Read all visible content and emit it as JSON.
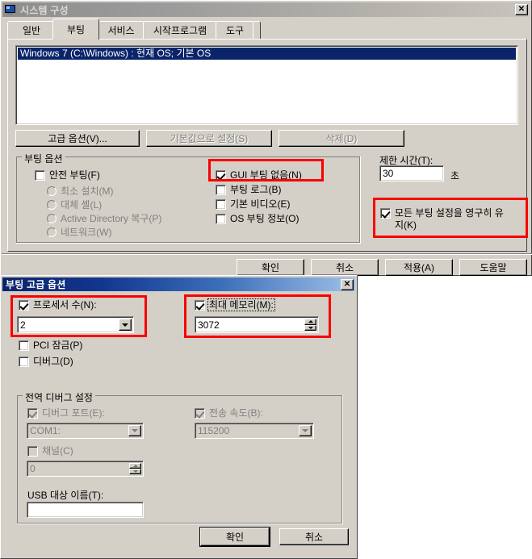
{
  "main_window": {
    "title": "시스템 구성",
    "icon": "system-config-icon",
    "close_label": "✕",
    "tabs": [
      {
        "label": "일반",
        "selected": false
      },
      {
        "label": "부팅",
        "selected": true
      },
      {
        "label": "서비스",
        "selected": false
      },
      {
        "label": "시작프로그램",
        "selected": false
      },
      {
        "label": "도구",
        "selected": false
      }
    ],
    "os_list": {
      "items": [
        {
          "text": "Windows 7 (C:\\Windows) : 현재 OS; 기본 OS",
          "selected": true
        }
      ]
    },
    "list_buttons": {
      "advanced": "고급 옵션(V)...",
      "set_default": "기본값으로 설정(S)",
      "delete": "삭제(D)"
    },
    "boot_options_group": {
      "title": "부팅 옵션",
      "safe_boot": {
        "label": "안전 부팅(F)",
        "checked": false
      },
      "safe_boot_modes": [
        {
          "label": "최소 설치(M)",
          "selected": false
        },
        {
          "label": "대체 셸(L)",
          "selected": false
        },
        {
          "label": "Active Directory 복구(P)",
          "selected": false
        },
        {
          "label": "네트워크(W)",
          "selected": false
        }
      ],
      "right_options": [
        {
          "label": "GUI 부팅 없음(N)",
          "checked": true,
          "highlighted": true
        },
        {
          "label": "부팅 로그(B)",
          "checked": false,
          "highlighted": false
        },
        {
          "label": "기본 비디오(E)",
          "checked": false,
          "highlighted": false
        },
        {
          "label": "OS 부팅 정보(O)",
          "checked": false,
          "highlighted": false
        }
      ]
    },
    "timeout": {
      "label": "제한 시간(T):",
      "value": "30",
      "unit": "초"
    },
    "make_permanent": {
      "label": "모든 부팅 설정을 영구히 유지(K)",
      "line1": "모든 부팅 설정을 영구히 유",
      "line2": "지(K)",
      "checked": true,
      "highlighted": true
    },
    "footer_buttons": [
      {
        "label": "확인",
        "default": false
      },
      {
        "label": "취소",
        "default": false
      },
      {
        "label": "적용(A)",
        "default": false
      },
      {
        "label": "도움말",
        "default": false
      }
    ]
  },
  "advanced_dialog": {
    "title": "부팅 고급 옵션",
    "close_label": "✕",
    "processor_count": {
      "label": "프로세서 수(N):",
      "checked": true,
      "value": "2",
      "highlighted": true
    },
    "max_memory": {
      "label": "최대 메모리(M):",
      "checked": true,
      "value": "3072",
      "focused": true,
      "highlighted": true
    },
    "pci_lock": {
      "label": "PCI 잠금(P)",
      "checked": false
    },
    "debug": {
      "label": "디버그(D)",
      "checked": false
    },
    "global_debug_group": {
      "title": "전역 디버그 설정",
      "debug_port": {
        "label": "디버그 포트(E):",
        "checked": true,
        "value": "COM1:",
        "disabled": true
      },
      "baud_rate": {
        "label": "전송 속도(B):",
        "checked": true,
        "value": "115200",
        "disabled": true
      },
      "channel": {
        "label": "채널(C)",
        "checked": false,
        "value": "0",
        "disabled": true
      },
      "usb_target": {
        "label": "USB 대상 이름(T):",
        "value": "",
        "disabled": false
      }
    },
    "footer_buttons": [
      {
        "label": "확인",
        "default": true
      },
      {
        "label": "취소",
        "default": false
      }
    ]
  },
  "colors": {
    "face": "#d4d0c8",
    "highlight_red": "#fa0000",
    "selection_blue": "#0a246a",
    "active_title_start": "#0a246a",
    "active_title_end": "#9fc0e8"
  }
}
